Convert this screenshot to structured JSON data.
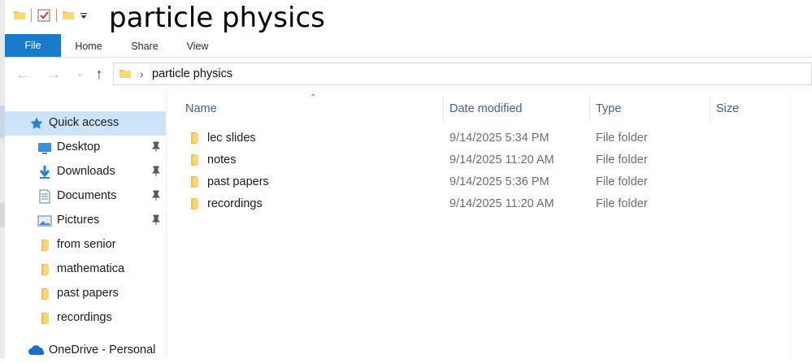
{
  "window": {
    "title": "particle physics"
  },
  "ribbon": {
    "tabs": [
      {
        "label": "File"
      },
      {
        "label": "Home"
      },
      {
        "label": "Share"
      },
      {
        "label": "View"
      }
    ]
  },
  "address": {
    "path": "particle physics"
  },
  "sidebar": {
    "items": [
      {
        "label": "Quick access",
        "icon": "star-icon"
      },
      {
        "label": "Desktop",
        "icon": "desktop-icon",
        "pinned": true
      },
      {
        "label": "Downloads",
        "icon": "download-icon",
        "pinned": true
      },
      {
        "label": "Documents",
        "icon": "documents-icon",
        "pinned": true
      },
      {
        "label": "Pictures",
        "icon": "pictures-icon",
        "pinned": true
      },
      {
        "label": "from senior",
        "icon": "folder-icon"
      },
      {
        "label": "mathematica",
        "icon": "folder-icon"
      },
      {
        "label": "past papers",
        "icon": "folder-icon"
      },
      {
        "label": "recordings",
        "icon": "folder-icon"
      },
      {
        "label": "OneDrive - Personal",
        "icon": "onedrive-icon"
      }
    ]
  },
  "columns": {
    "name": "Name",
    "date": "Date modified",
    "type": "Type",
    "size": "Size"
  },
  "files": [
    {
      "name": "lec slides",
      "date": "9/14/2025 5:34 PM",
      "type": "File folder"
    },
    {
      "name": "notes",
      "date": "9/14/2025 11:20 AM",
      "type": "File folder"
    },
    {
      "name": "past papers",
      "date": "9/14/2025 5:36 PM",
      "type": "File folder"
    },
    {
      "name": "recordings",
      "date": "9/14/2025 11:20 AM",
      "type": "File folder"
    }
  ],
  "colors": {
    "accent": "#1979ca",
    "selection": "#cce4f7",
    "folder": "#f4c23d"
  }
}
